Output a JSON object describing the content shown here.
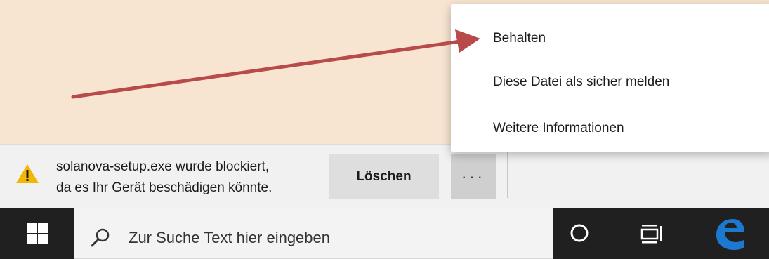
{
  "download_bar": {
    "message_line1": "solanova-setup.exe wurde blockiert,",
    "message_line2": "da es Ihr Gerät beschädigen könnte.",
    "delete_label": "Löschen",
    "more_label": "···"
  },
  "context_menu": {
    "items": [
      {
        "label": "Behalten"
      },
      {
        "label": "Diese Datei als sicher melden"
      },
      {
        "label": "Weitere Informationen"
      }
    ]
  },
  "taskbar": {
    "search_placeholder": "Zur Suche Text hier eingeben",
    "icons": [
      "windows-start-icon",
      "search-icon",
      "cortana-icon",
      "task-view-icon",
      "edge-browser-icon"
    ]
  },
  "colors": {
    "page_background": "#f7e5d1",
    "warning": "#f2b705",
    "arrow": "#b84a4a",
    "taskbar": "#202020",
    "edge_blue": "#1d78d0"
  }
}
